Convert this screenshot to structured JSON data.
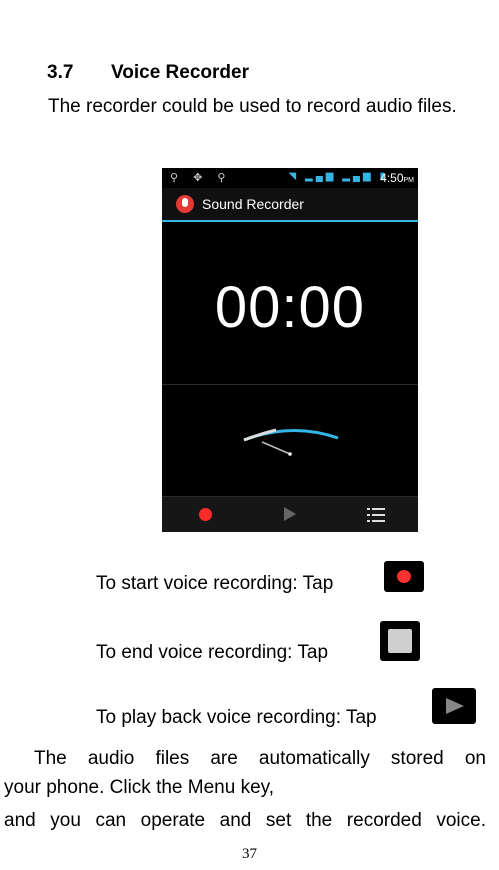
{
  "section": {
    "number": "3.7",
    "title": "Voice Recorder"
  },
  "intro": "The recorder could be used to record audio files.",
  "phone": {
    "status_time": "4:50",
    "status_time_suffix": "PM",
    "app_title": "Sound Recorder",
    "timer": "00:00",
    "icons": [
      "usb-icon",
      "settings-icon",
      "usb-icon",
      "wifi-icon",
      "signal-icon",
      "signal-icon",
      "battery-icon",
      "microphone-icon",
      "record-icon",
      "play-icon",
      "list-icon"
    ],
    "accent_color": "#33b5e5",
    "record_color": "#ff2a2a"
  },
  "instructions": [
    {
      "text": "To start voice recording: Tap",
      "icon": "record-icon"
    },
    {
      "text": "To end voice recording: Tap",
      "icon": "stop-icon"
    },
    {
      "text": "To play back voice recording: Tap",
      "icon": "play-icon"
    }
  ],
  "closing_line1": "The audio files are automatically stored on",
  "closing_line2": "your phone. Click the Menu key,",
  "closing_line3": "and you can operate and set the recorded voice.",
  "page_number": "37"
}
